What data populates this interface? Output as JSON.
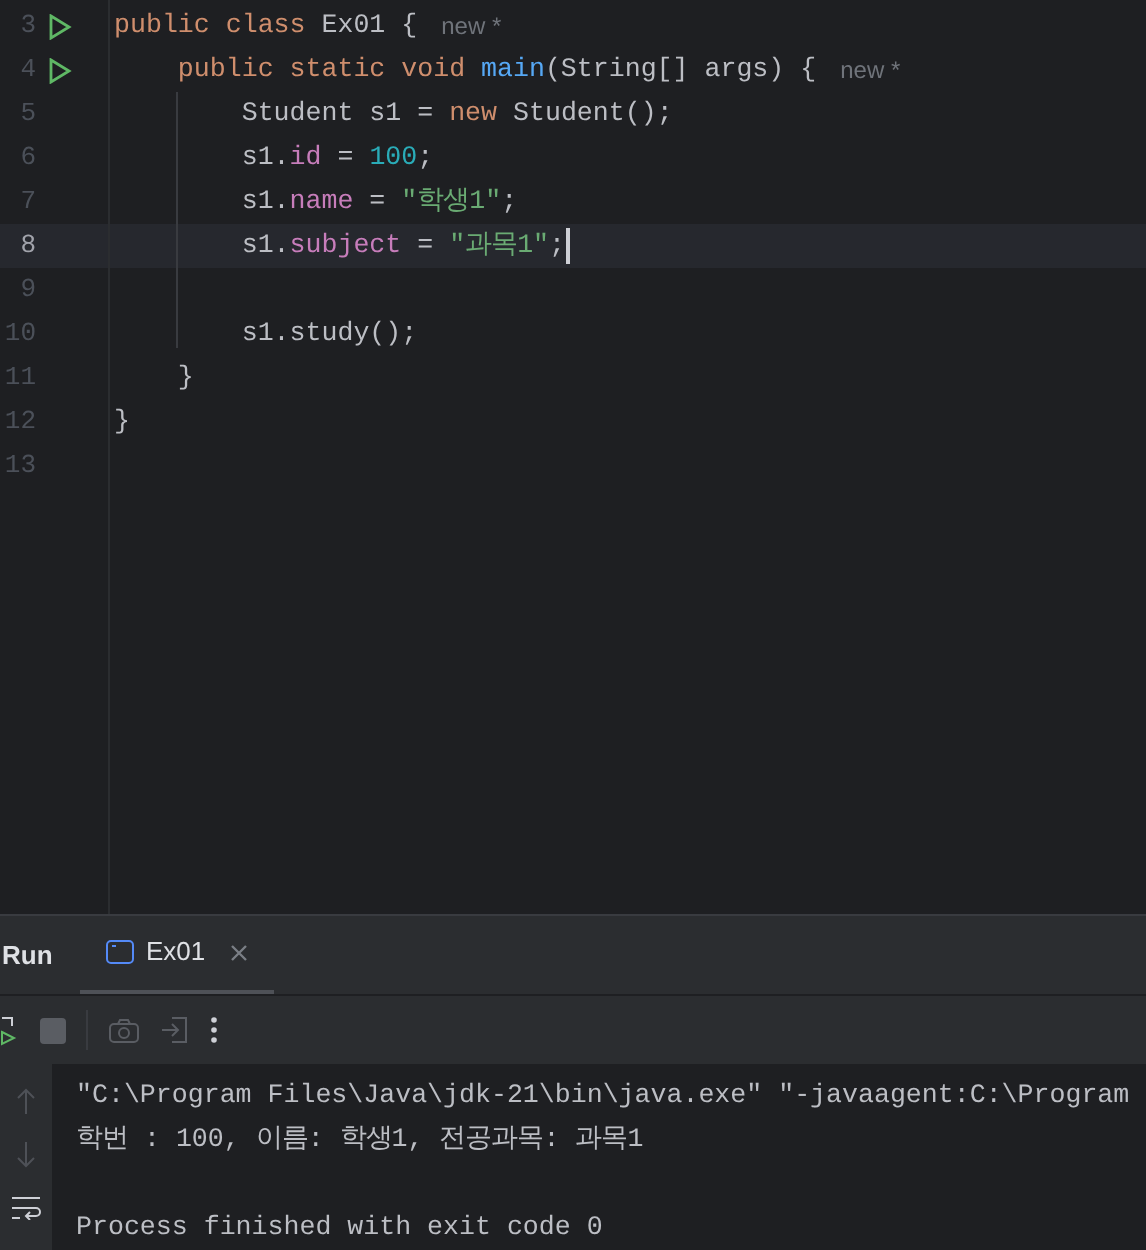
{
  "editor": {
    "lines": [
      {
        "number": "3",
        "run": true,
        "current": false,
        "caret": false,
        "hint": "new *",
        "tokens": [
          {
            "kind": "kw",
            "text": "public class "
          },
          {
            "kind": "plain",
            "text": "Ex01 {"
          }
        ]
      },
      {
        "number": "4",
        "run": true,
        "current": false,
        "caret": false,
        "hint": "new *",
        "tokens": [
          {
            "kind": "kw",
            "text": "    public static void "
          },
          {
            "kind": "method",
            "text": "main"
          },
          {
            "kind": "plain",
            "text": "(String[] args) {"
          }
        ]
      },
      {
        "number": "5",
        "run": false,
        "current": false,
        "caret": false,
        "tokens": [
          {
            "kind": "plain",
            "text": "        Student s1 = "
          },
          {
            "kind": "kw",
            "text": "new "
          },
          {
            "kind": "plain",
            "text": "Student();"
          }
        ]
      },
      {
        "number": "6",
        "run": false,
        "current": false,
        "caret": false,
        "tokens": [
          {
            "kind": "plain",
            "text": "        s1."
          },
          {
            "kind": "field",
            "text": "id"
          },
          {
            "kind": "plain",
            "text": " = "
          },
          {
            "kind": "num",
            "text": "100"
          },
          {
            "kind": "plain",
            "text": ";"
          }
        ]
      },
      {
        "number": "7",
        "run": false,
        "current": false,
        "caret": false,
        "tokens": [
          {
            "kind": "plain",
            "text": "        s1."
          },
          {
            "kind": "field",
            "text": "name"
          },
          {
            "kind": "plain",
            "text": " = "
          },
          {
            "kind": "str",
            "text": "\"학생1\""
          },
          {
            "kind": "plain",
            "text": ";"
          }
        ]
      },
      {
        "number": "8",
        "run": false,
        "current": true,
        "caret": true,
        "tokens": [
          {
            "kind": "plain",
            "text": "        s1."
          },
          {
            "kind": "field",
            "text": "subject"
          },
          {
            "kind": "plain",
            "text": " = "
          },
          {
            "kind": "str",
            "text": "\"과목1\""
          },
          {
            "kind": "plain",
            "text": ";"
          }
        ]
      },
      {
        "number": "9",
        "run": false,
        "current": false,
        "caret": false
      },
      {
        "number": "10",
        "run": false,
        "current": false,
        "caret": false,
        "tokens": [
          {
            "kind": "plain",
            "text": "        s1.study();"
          }
        ]
      },
      {
        "number": "11",
        "run": false,
        "current": false,
        "caret": false,
        "tokens": [
          {
            "kind": "plain",
            "text": "    }"
          }
        ]
      },
      {
        "number": "12",
        "run": false,
        "current": false,
        "caret": false,
        "tokens": [
          {
            "kind": "plain",
            "text": "}"
          }
        ]
      },
      {
        "number": "13",
        "run": false,
        "current": false,
        "caret": false
      }
    ]
  },
  "run_panel": {
    "title": "Run",
    "tabs": [
      {
        "label": "Ex01",
        "selected": true
      }
    ],
    "console": [
      {
        "kind": "command",
        "text": "\"C:\\Program Files\\Java\\jdk-21\\bin\\java.exe\" \"-javaagent:C:\\Program"
      },
      {
        "kind": "output",
        "text": "학번 : 100, 이름: 학생1, 전공과목: 과목1"
      },
      {
        "kind": "exit",
        "text": "Process finished with exit code 0"
      }
    ]
  }
}
